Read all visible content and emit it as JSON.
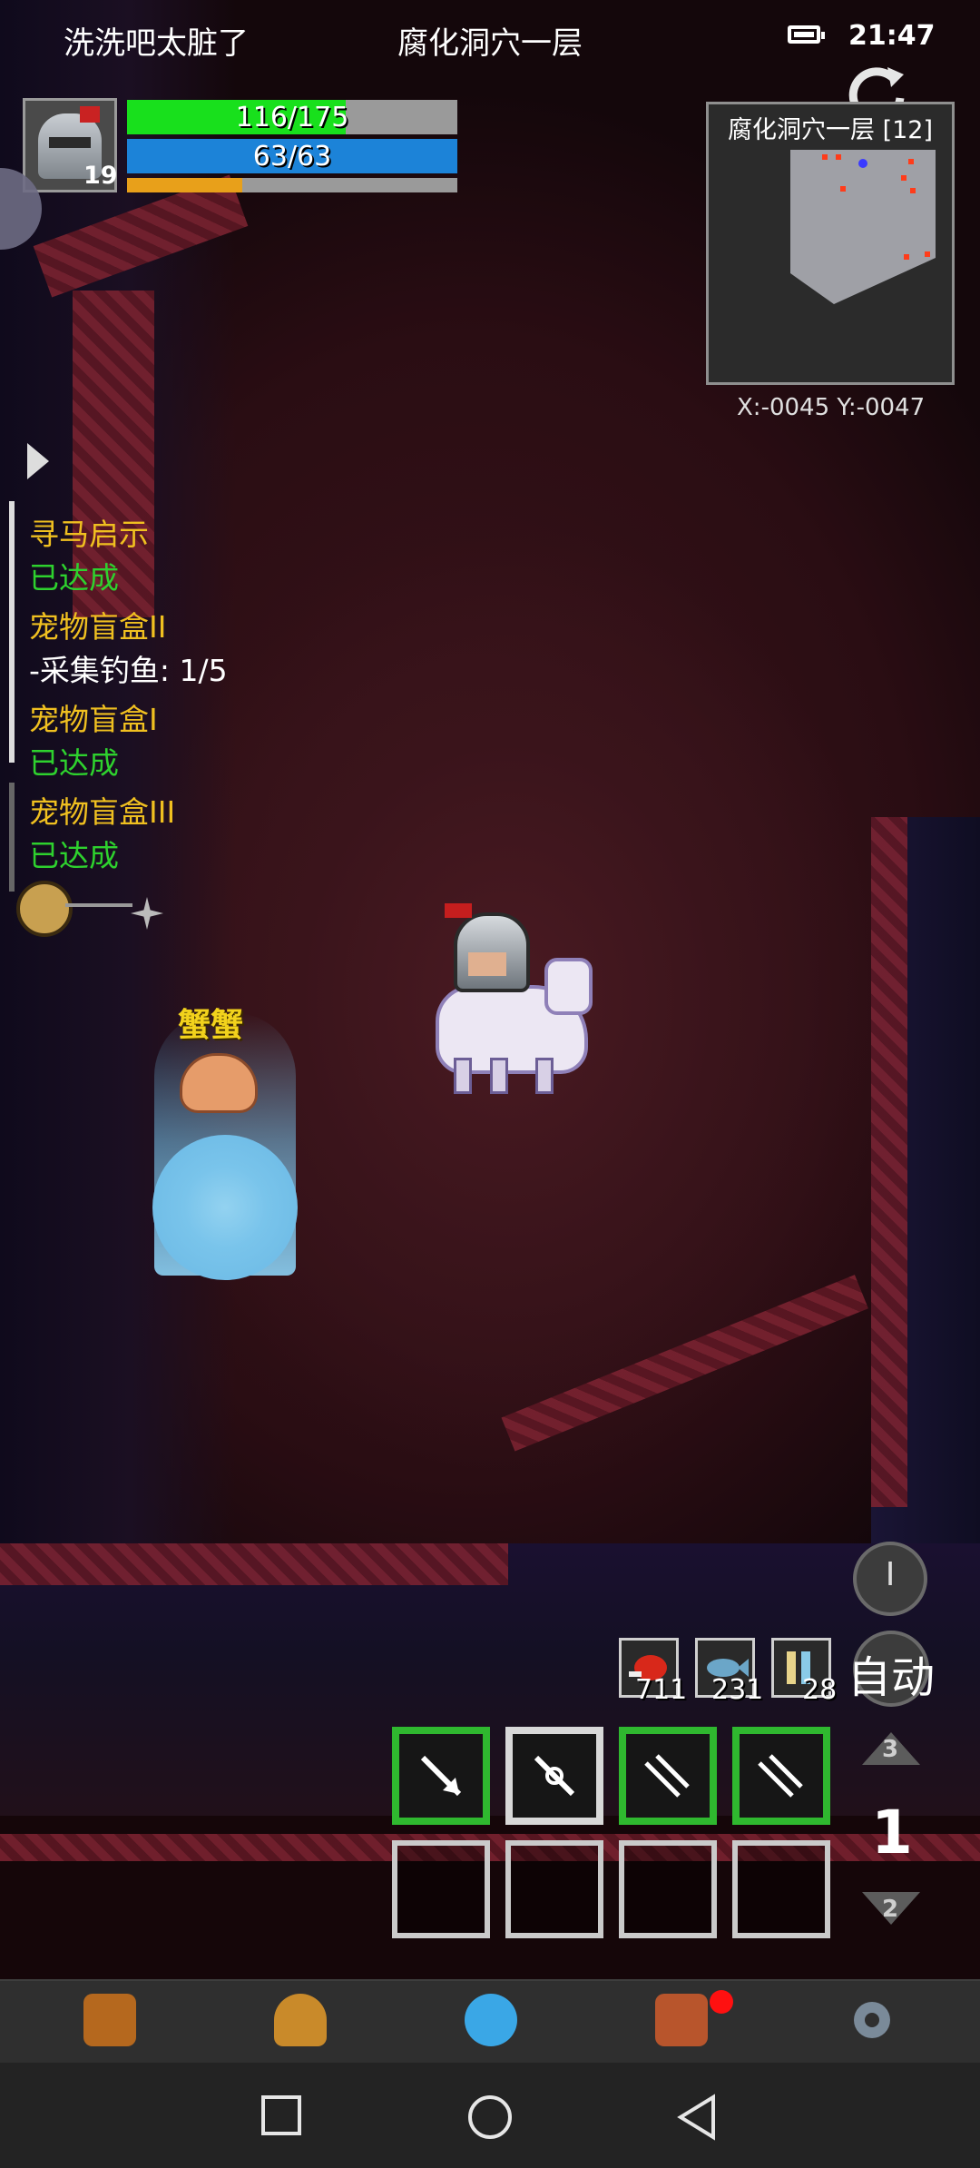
{
  "status": {
    "left_text": "洗洗吧太脏了",
    "center_text": "腐化洞穴一层",
    "time": "21:47"
  },
  "player": {
    "level": "19",
    "hp_text": "116/175",
    "hp_fraction": 0.663,
    "mp_text": "63/63",
    "mp_fraction": 1.0,
    "xp_fraction": 0.35
  },
  "minimap": {
    "title": "腐化洞穴一层 [12]",
    "coords": "X:-0045  Y:-0047"
  },
  "quests": [
    {
      "title": "寻马启示",
      "status": "已达成",
      "status_type": "done"
    },
    {
      "title": "宠物盲盒II",
      "status": "-采集钓鱼: 1/5",
      "status_type": "progress"
    },
    {
      "title": "宠物盲盒I",
      "status": "已达成",
      "status_type": "done"
    },
    {
      "title": "宠物盲盒III",
      "status": "已达成",
      "status_type": "done"
    }
  ],
  "enemy": {
    "name": "蟹蟹"
  },
  "controls": {
    "mode_label": "I",
    "auto_label": "自动"
  },
  "items": [
    {
      "icon": "meat-icon",
      "count": "711"
    },
    {
      "icon": "fish-icon",
      "count": "231"
    },
    {
      "icon": "potion-icon",
      "count": "28"
    }
  ],
  "skills": [
    {
      "icon": "arrow-shot-icon",
      "style": "green"
    },
    {
      "icon": "crosshair-arrow-icon",
      "style": "white"
    },
    {
      "icon": "multi-arrow-icon",
      "style": "green"
    },
    {
      "icon": "multi-arrow-icon",
      "style": "green"
    }
  ],
  "skill_page": {
    "current": "1",
    "up": "3",
    "down": "2"
  },
  "tabs": [
    {
      "label": "属性",
      "icon": "helmet-icon",
      "color": "#b5681e"
    },
    {
      "label": "装备",
      "icon": "bag-icon",
      "color": "#c98a2a"
    },
    {
      "label": "技能",
      "icon": "orb-icon",
      "color": "#3aa7e6"
    },
    {
      "label": "收集",
      "icon": "chest-icon",
      "color": "#b8552c",
      "notification": true
    },
    {
      "label": "设置",
      "icon": "gear-icon",
      "color": "#7a8a99"
    }
  ],
  "colors": {
    "hp": "#18e01c",
    "mp": "#1c83d8",
    "xp": "#e8a01a",
    "quest_title": "#f0c020",
    "quest_done": "#2ed12e",
    "skill_border": "#2fb82f"
  }
}
